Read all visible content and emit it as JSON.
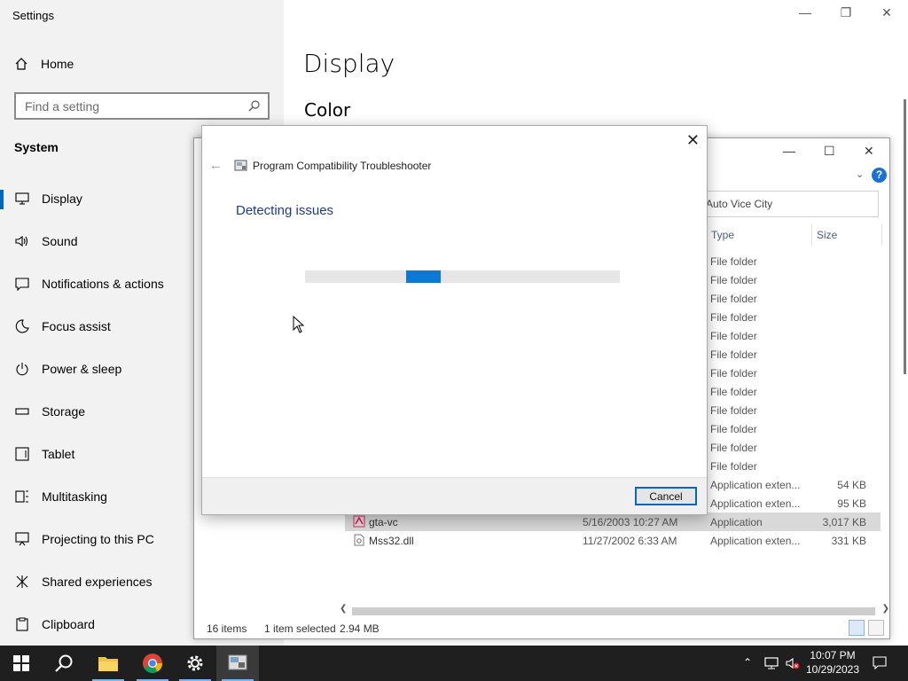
{
  "settings": {
    "window_title": "Settings",
    "home_label": "Home",
    "search_placeholder": "Find a setting",
    "section_title": "System",
    "nav_items": [
      {
        "label": "Display",
        "icon": "monitor-icon"
      },
      {
        "label": "Sound",
        "icon": "speaker-icon"
      },
      {
        "label": "Notifications & actions",
        "icon": "notification-icon"
      },
      {
        "label": "Focus assist",
        "icon": "moon-icon"
      },
      {
        "label": "Power & sleep",
        "icon": "power-icon"
      },
      {
        "label": "Storage",
        "icon": "storage-icon"
      },
      {
        "label": "Tablet",
        "icon": "tablet-icon"
      },
      {
        "label": "Multitasking",
        "icon": "multitasking-icon"
      },
      {
        "label": "Projecting to this PC",
        "icon": "projecting-icon"
      },
      {
        "label": "Shared experiences",
        "icon": "shared-icon"
      },
      {
        "label": "Clipboard",
        "icon": "clipboard-icon"
      }
    ],
    "page_title": "Display",
    "sub_heading": "Color"
  },
  "explorer": {
    "search_value": "Auto Vice City",
    "columns": {
      "type": "Type",
      "size": "Size"
    },
    "rows": [
      {
        "name": "",
        "date": "",
        "type": "File folder",
        "size": ""
      },
      {
        "name": "",
        "date": "",
        "type": "File folder",
        "size": ""
      },
      {
        "name": "",
        "date": "",
        "type": "File folder",
        "size": ""
      },
      {
        "name": "",
        "date": "",
        "type": "File folder",
        "size": ""
      },
      {
        "name": "",
        "date": "",
        "type": "File folder",
        "size": ""
      },
      {
        "name": "",
        "date": "",
        "type": "File folder",
        "size": ""
      },
      {
        "name": "",
        "date": "",
        "type": "File folder",
        "size": ""
      },
      {
        "name": "",
        "date": "",
        "type": "File folder",
        "size": ""
      },
      {
        "name": "",
        "date": "",
        "type": "File folder",
        "size": ""
      },
      {
        "name": "",
        "date": "",
        "type": "File folder",
        "size": ""
      },
      {
        "name": "",
        "date": "",
        "type": "File folder",
        "size": ""
      },
      {
        "name": "",
        "date": "",
        "type": "File folder",
        "size": ""
      },
      {
        "name": "",
        "date": "",
        "type": "Application exten...",
        "size": "54 KB"
      },
      {
        "name": "",
        "date": "",
        "type": "Application exten...",
        "size": "95 KB"
      },
      {
        "name": "gta-vc",
        "date": "5/16/2003 10:27 AM",
        "type": "Application",
        "size": "3,017 KB",
        "selected": true
      },
      {
        "name": "Mss32.dll",
        "date": "11/27/2002 6:33 AM",
        "type": "Application exten...",
        "size": "331 KB"
      }
    ],
    "status_items": "16 items",
    "status_selected": "1 item selected",
    "status_size": "2.94 MB"
  },
  "dialog": {
    "title": "Program Compatibility Troubleshooter",
    "heading": "Detecting issues",
    "progress_chunk_offset_pct": 32,
    "cancel_label": "Cancel"
  },
  "taskbar": {
    "apps": [
      "windows-start-icon",
      "search-icon",
      "file-explorer-icon",
      "chrome-icon",
      "settings-gear-icon",
      "troubleshooter-icon"
    ],
    "time": "10:07 PM",
    "date": "10/29/2023"
  },
  "colors": {
    "accent": "#0067c0",
    "progress": "#0e78d5",
    "taskbar": "#1f1f1f",
    "heading": "#1e3a8a"
  }
}
